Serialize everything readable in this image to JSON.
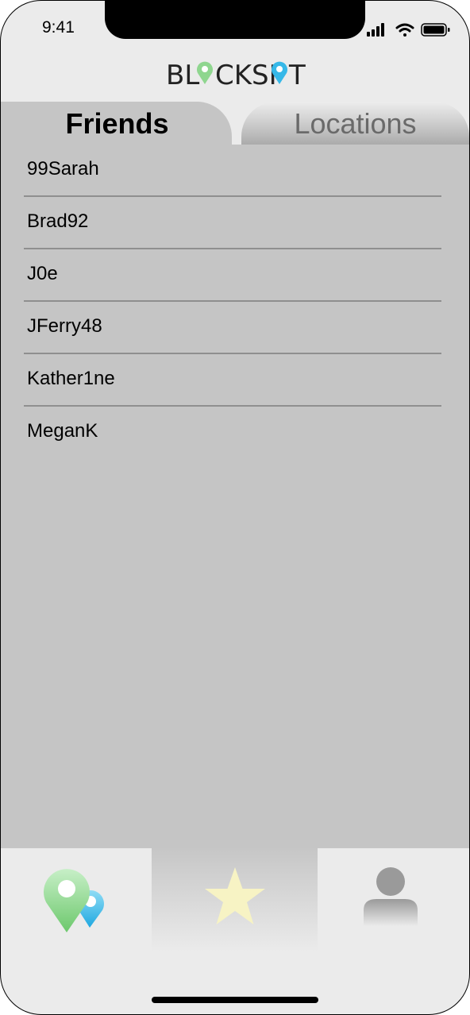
{
  "status_bar": {
    "time": "9:41"
  },
  "header": {
    "logo_text": "BLOCKSPOT"
  },
  "tabs": [
    {
      "label": "Friends",
      "selected": true
    },
    {
      "label": "Locations",
      "selected": false
    }
  ],
  "friends": [
    "99Sarah",
    "Brad92",
    "J0e",
    "JFerry48",
    "Kather1ne",
    "MeganK"
  ],
  "bottom_nav": [
    {
      "icon": "map-pins-icon"
    },
    {
      "icon": "star-icon",
      "selected": true
    },
    {
      "icon": "person-icon"
    }
  ],
  "colors": {
    "pin_green": "#8fd68f",
    "pin_blue": "#36b8e8",
    "star": "#f7f3c4",
    "panel": "#c5c5c5"
  }
}
